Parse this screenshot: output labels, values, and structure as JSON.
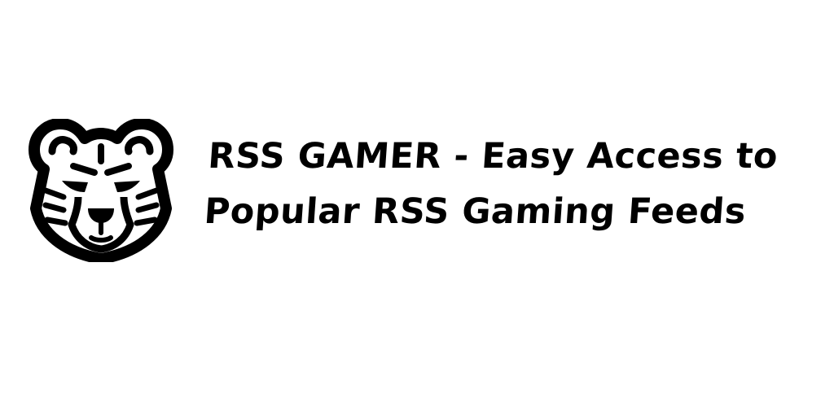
{
  "banner": {
    "logo": {
      "icon": "tiger-head-icon",
      "color": "#000000"
    },
    "title_line_1": "RSS GAMER - Easy Access to",
    "title_line_2": "Popular RSS Gaming Feeds",
    "text_color": "#000000",
    "background": "#ffffff"
  }
}
